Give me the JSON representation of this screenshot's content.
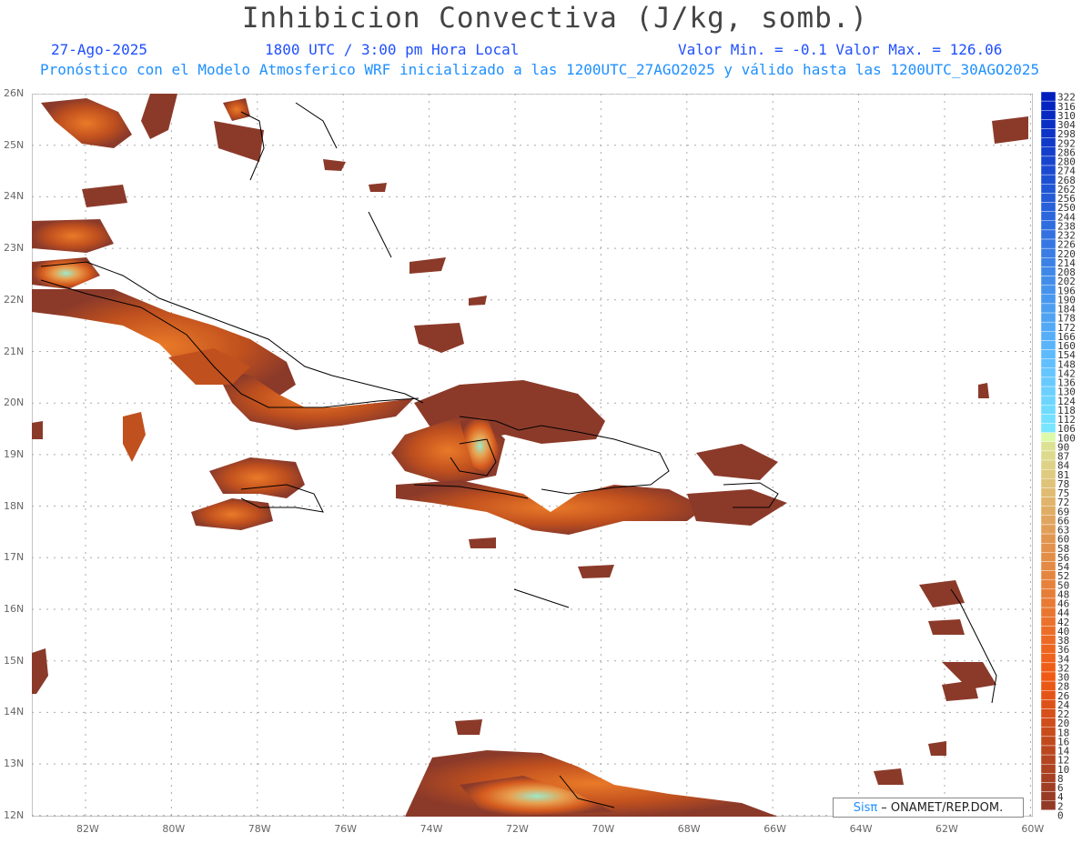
{
  "title": "Inhibicion Convectiva (J/kg, somb.)",
  "date": "27-Ago-2025",
  "time": "1800 UTC / 3:00 pm Hora Local",
  "stats": "Valor Min. = -0.1  Valor Max. = 126.06",
  "forecast": "Pronóstico con el Modelo Atmosferico WRF inicializado a las 1200UTC_27AGO2025 y válido hasta las  1200UTC_30AGO2025",
  "credit": {
    "logo": "Sisπ",
    "text": "– ONAMET/REP.DOM."
  },
  "lat_labels": [
    "26N",
    "25N",
    "24N",
    "23N",
    "22N",
    "21N",
    "20N",
    "19N",
    "18N",
    "17N",
    "16N",
    "15N",
    "14N",
    "13N",
    "12N"
  ],
  "lon_labels": [
    "82W",
    "80W",
    "78W",
    "76W",
    "74W",
    "72W",
    "70W",
    "68W",
    "66W",
    "64W",
    "62W",
    "60W"
  ],
  "colorbar": {
    "labels": [
      "322",
      "316",
      "310",
      "304",
      "298",
      "292",
      "286",
      "280",
      "274",
      "268",
      "262",
      "256",
      "250",
      "244",
      "238",
      "232",
      "226",
      "220",
      "214",
      "208",
      "202",
      "196",
      "190",
      "184",
      "178",
      "172",
      "166",
      "160",
      "154",
      "148",
      "142",
      "136",
      "130",
      "124",
      "118",
      "112",
      "106",
      "100",
      "90",
      "87",
      "84",
      "81",
      "78",
      "75",
      "72",
      "69",
      "66",
      "63",
      "60",
      "58",
      "56",
      "54",
      "52",
      "50",
      "48",
      "46",
      "44",
      "42",
      "40",
      "38",
      "36",
      "34",
      "32",
      "30",
      "28",
      "26",
      "24",
      "22",
      "20",
      "18",
      "16",
      "14",
      "12",
      "10",
      "8",
      "6",
      "4",
      "2",
      "0"
    ]
  },
  "colors": {
    "cin_low": "#8b3a2a",
    "cin_mid": "#e0661a",
    "cin_high": "#7fe0c0",
    "coast": "#000000",
    "grid": "#aaaaaa"
  }
}
